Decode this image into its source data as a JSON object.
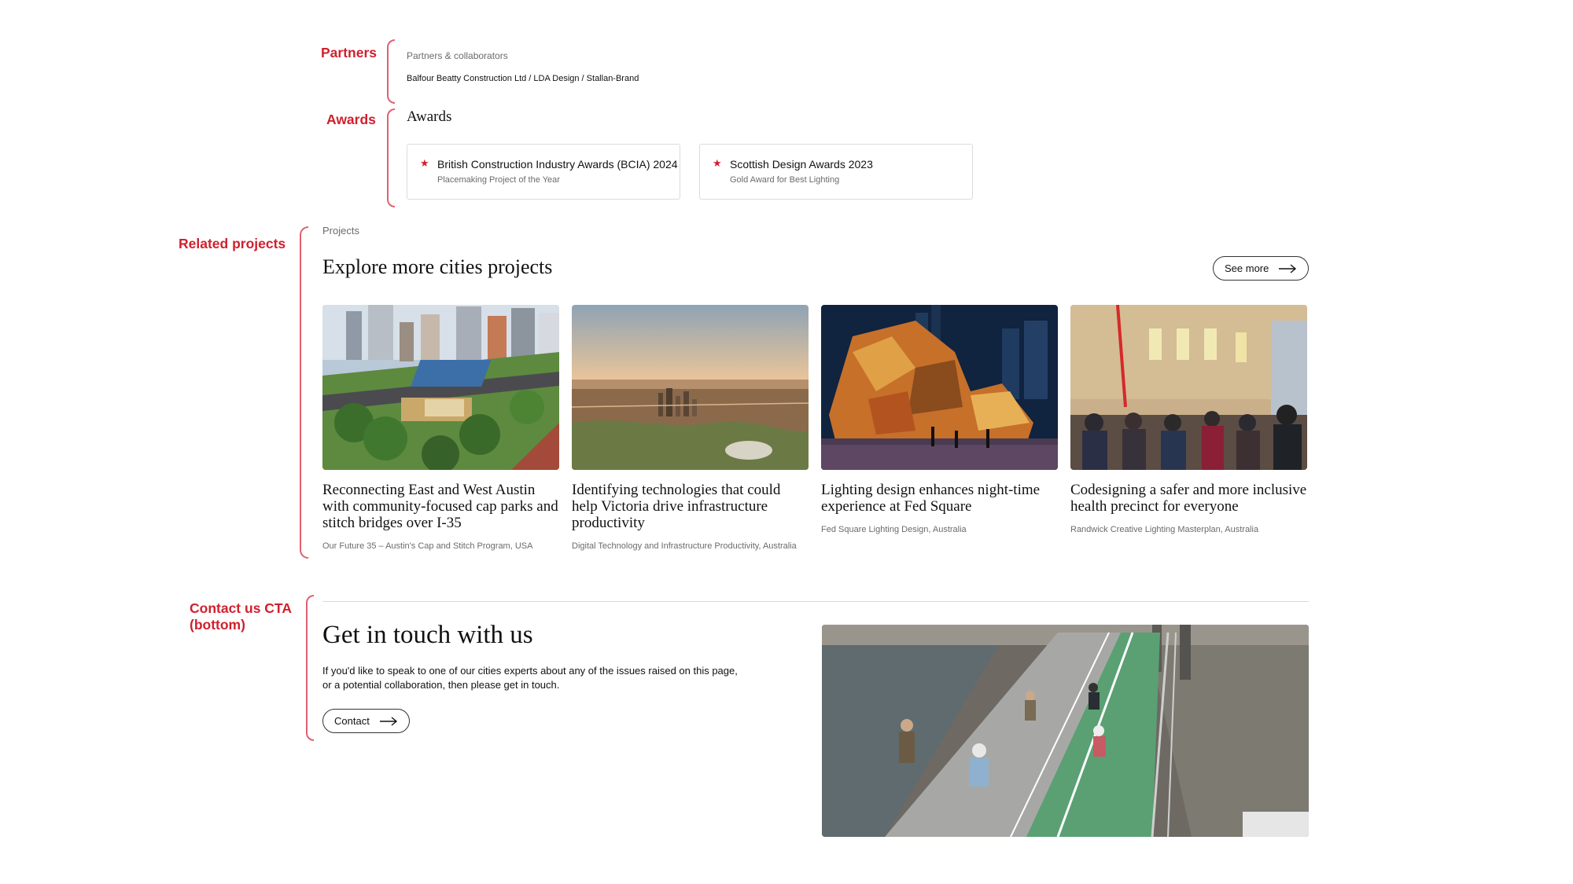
{
  "annotations": {
    "partners": "Partners",
    "awards": "Awards",
    "related_projects": "Related projects",
    "contact_cta_line1": "Contact us CTA",
    "contact_cta_line2": "(bottom)"
  },
  "partners": {
    "eyebrow": "Partners & collaborators",
    "names": "Balfour Beatty Construction Ltd / LDA Design / Stallan-Brand"
  },
  "awards": {
    "heading": "Awards",
    "items": [
      {
        "title": "British Construction Industry Awards (BCIA) 2024",
        "subtitle": "Placemaking Project of the Year",
        "icon": "star-icon"
      },
      {
        "title": "Scottish Design Awards 2023",
        "subtitle": "Gold Award for Best Lighting",
        "icon": "star-icon"
      }
    ]
  },
  "projects": {
    "eyebrow": "Projects",
    "heading": "Explore more cities projects",
    "see_more_label": "See more",
    "cards": [
      {
        "title": "Reconnecting East and West Austin with community-focused cap parks and stitch bridges over I-35",
        "meta": "Our Future 35 – Austin's Cap and Stitch Program, USA"
      },
      {
        "title": "Identifying technologies that could help Victoria drive infrastructure productivity",
        "meta": "Digital Technology and Infrastructure Productivity, Australia"
      },
      {
        "title": "Lighting design enhances night-time experience at Fed Square",
        "meta": "Fed Square Lighting Design, Australia"
      },
      {
        "title": "Codesigning a safer and more inclusive health precinct for everyone",
        "meta": "Randwick Creative Lighting Masterplan, Australia"
      }
    ]
  },
  "contact": {
    "heading": "Get in touch with us",
    "body": "If you'd like to speak to one of our cities experts about any of the issues raised on this page, or a potential collaboration, then please get in touch.",
    "button_label": "Contact"
  },
  "colors": {
    "annotation_red": "#d0202e",
    "bracket_pink": "#e06070",
    "text_dark": "#111111",
    "text_muted": "#6b6b6b"
  }
}
